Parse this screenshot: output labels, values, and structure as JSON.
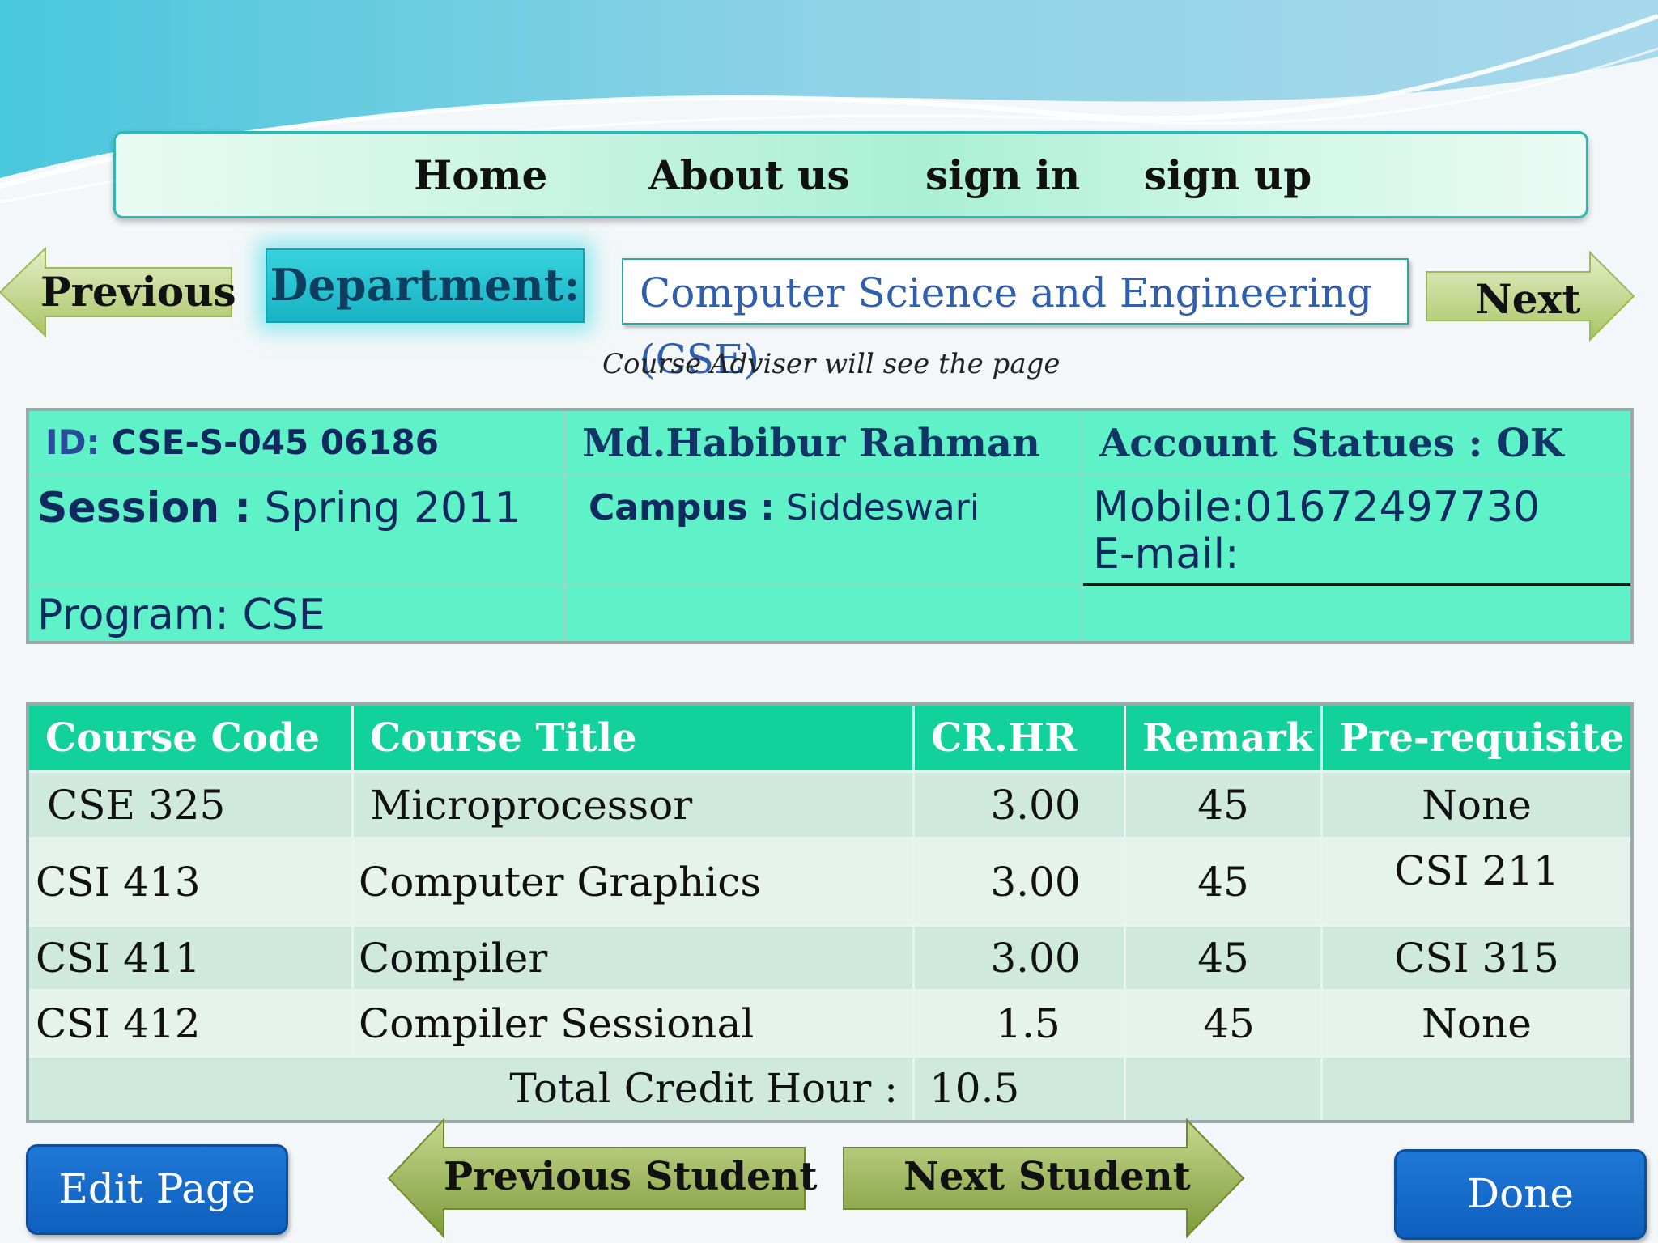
{
  "nav": {
    "home": "Home",
    "about": "About us",
    "signin": "sign in",
    "signup": "sign up"
  },
  "controls": {
    "previous": "Previous",
    "next": "Next",
    "department_label": "Department:",
    "department_value": "Computer Science and Engineering (CSE)"
  },
  "note": "Course Adviser will see the page",
  "student": {
    "id_label": "ID:",
    "id_value": "CSE-S-045 06186",
    "name": "Md.Habibur  Rahman",
    "account_status": "Account Statues :  OK",
    "session_label": "Session :",
    "session_value": "Spring 2011",
    "campus_label": "Campus :",
    "campus_value": "Siddeswari",
    "mobile": "Mobile:01672497730",
    "email": "E-mail:",
    "program": "Program: CSE"
  },
  "courses": {
    "headers": [
      "Course Code",
      "Course Title",
      "CR.HR",
      "Remark",
      "Pre-requisite"
    ],
    "rows": [
      [
        "CSE 325",
        "Microprocessor",
        "3.00",
        "45",
        "None"
      ],
      [
        "CSI 413",
        "Computer Graphics",
        "3.00",
        "45",
        "CSI 211"
      ],
      [
        "CSI 411",
        "Compiler",
        "3.00",
        "45",
        "CSI 315"
      ],
      [
        "CSI 412",
        "Compiler Sessional",
        "1.5",
        "45",
        "None"
      ]
    ],
    "total_label": "Total Credit Hour :",
    "total_value": "10.5"
  },
  "buttons": {
    "edit": "Edit Page",
    "prev_student": "Previous Student",
    "next_student": "Next Student",
    "done": "Done"
  },
  "colors": {
    "nav_border": "#2fb7b2",
    "info_bg": "#5ff2c9",
    "header_bg": "#12d19a",
    "button_blue": "#1f78d6",
    "arrow_green": "#9bbb59"
  }
}
